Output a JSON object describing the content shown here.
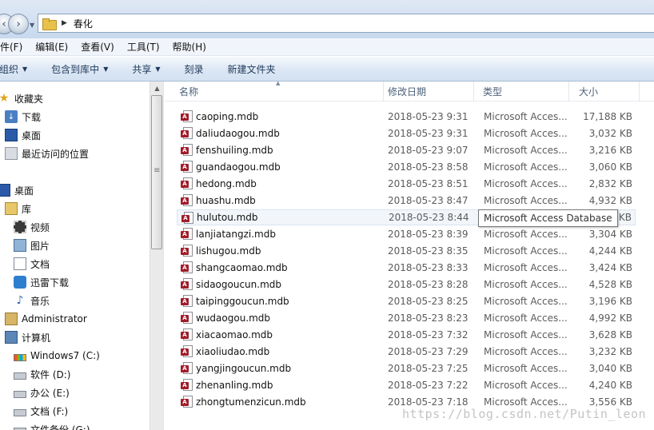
{
  "address": {
    "crumb": "春化"
  },
  "menu": [
    "件(F)",
    "编辑(E)",
    "查看(V)",
    "工具(T)",
    "帮助(H)"
  ],
  "commands": {
    "organize": "组织",
    "include_library": "包含到库中",
    "share": "共享",
    "burn": "刻录",
    "new_folder": "新建文件夹"
  },
  "nav": {
    "favorites": "收藏夹",
    "downloads": "下载",
    "desktop_fav": "桌面",
    "recent": "最近访问的位置",
    "desktop": "桌面",
    "libraries": "库",
    "videos": "视频",
    "pictures": "图片",
    "documents": "文档",
    "xunlei": "迅雷下载",
    "music": "音乐",
    "admin": "Administrator",
    "computer": "计算机",
    "drive_c": "Windows7 (C:)",
    "drive_d": "软件 (D:)",
    "drive_e": "办公 (E:)",
    "drive_f": "文档 (F:)",
    "drive_g": "文件备份 (G:)"
  },
  "columns": {
    "name": "名称",
    "date": "修改日期",
    "type": "类型",
    "size": "大小"
  },
  "files": [
    {
      "name": "caoping.mdb",
      "date": "2018-05-23 9:31",
      "type": "Microsoft Acces...",
      "size": "17,188 KB"
    },
    {
      "name": "daliudaogou.mdb",
      "date": "2018-05-23 9:31",
      "type": "Microsoft Acces...",
      "size": "3,032 KB"
    },
    {
      "name": "fenshuiling.mdb",
      "date": "2018-05-23 9:07",
      "type": "Microsoft Acces...",
      "size": "3,216 KB"
    },
    {
      "name": "guandaogou.mdb",
      "date": "2018-05-23 8:58",
      "type": "Microsoft Acces...",
      "size": "3,060 KB"
    },
    {
      "name": "hedong.mdb",
      "date": "2018-05-23 8:51",
      "type": "Microsoft Acces...",
      "size": "2,832 KB"
    },
    {
      "name": "huashu.mdb",
      "date": "2018-05-23 8:47",
      "type": "Microsoft Acces...",
      "size": "4,932 KB"
    },
    {
      "name": "hulutou.mdb",
      "date": "2018-05-23 8:44",
      "type": "Microsoft Acces...",
      "size": "KB"
    },
    {
      "name": "lanjiatangzi.mdb",
      "date": "2018-05-23 8:39",
      "type": "Microsoft Acces...",
      "size": "3,304 KB"
    },
    {
      "name": "lishugou.mdb",
      "date": "2018-05-23 8:35",
      "type": "Microsoft Acces...",
      "size": "4,244 KB"
    },
    {
      "name": "shangcaomao.mdb",
      "date": "2018-05-23 8:33",
      "type": "Microsoft Acces...",
      "size": "3,424 KB"
    },
    {
      "name": "sidaogoucun.mdb",
      "date": "2018-05-23 8:28",
      "type": "Microsoft Acces...",
      "size": "4,528 KB"
    },
    {
      "name": "taipinggoucun.mdb",
      "date": "2018-05-23 8:25",
      "type": "Microsoft Acces...",
      "size": "3,196 KB"
    },
    {
      "name": "wudaogou.mdb",
      "date": "2018-05-23 8:23",
      "type": "Microsoft Acces...",
      "size": "4,992 KB"
    },
    {
      "name": "xiacaomao.mdb",
      "date": "2018-05-23 7:32",
      "type": "Microsoft Acces...",
      "size": "3,628 KB"
    },
    {
      "name": "xiaoliudao.mdb",
      "date": "2018-05-23 7:29",
      "type": "Microsoft Acces...",
      "size": "3,232 KB"
    },
    {
      "name": "yangjingoucun.mdb",
      "date": "2018-05-23 7:25",
      "type": "Microsoft Acces...",
      "size": "3,040 KB"
    },
    {
      "name": "zhenanling.mdb",
      "date": "2018-05-23 7:22",
      "type": "Microsoft Acces...",
      "size": "4,240 KB"
    },
    {
      "name": "zhongtumenzicun.mdb",
      "date": "2018-05-23 7:18",
      "type": "Microsoft Acces...",
      "size": "3,556 KB"
    }
  ],
  "tooltip": "Microsoft Access Database",
  "watermark": "https://blog.csdn.net/Putin_leon"
}
